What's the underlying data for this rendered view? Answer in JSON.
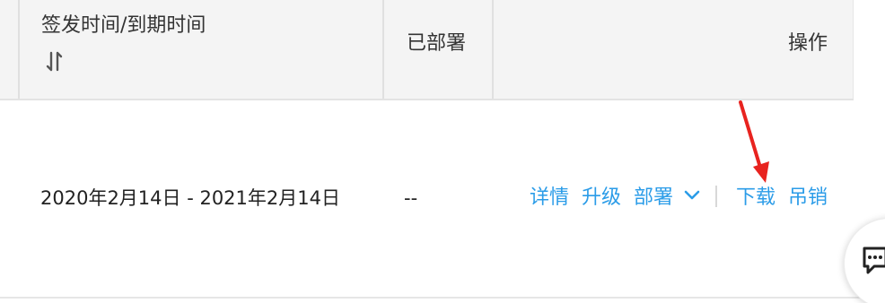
{
  "table": {
    "header": {
      "col_time": "签发时间/到期时间",
      "col_deployed": "已部署",
      "col_actions": "操作"
    },
    "row": {
      "time_range": "2020年2月14日 - 2021年2月14日",
      "deployed": "--",
      "actions": {
        "details": "详情",
        "upgrade": "升级",
        "deploy": "部署",
        "download": "下载",
        "revoke": "吊销"
      }
    }
  },
  "icons": {
    "sort": "sort-icon",
    "deploy_dropdown": "chevron-down-icon",
    "chat": "chat-icon",
    "annotation": "red-arrow-icon"
  },
  "colors": {
    "link": "#2b9ce8",
    "header_bg": "#f4f4f4",
    "annotation": "#e8231f"
  }
}
